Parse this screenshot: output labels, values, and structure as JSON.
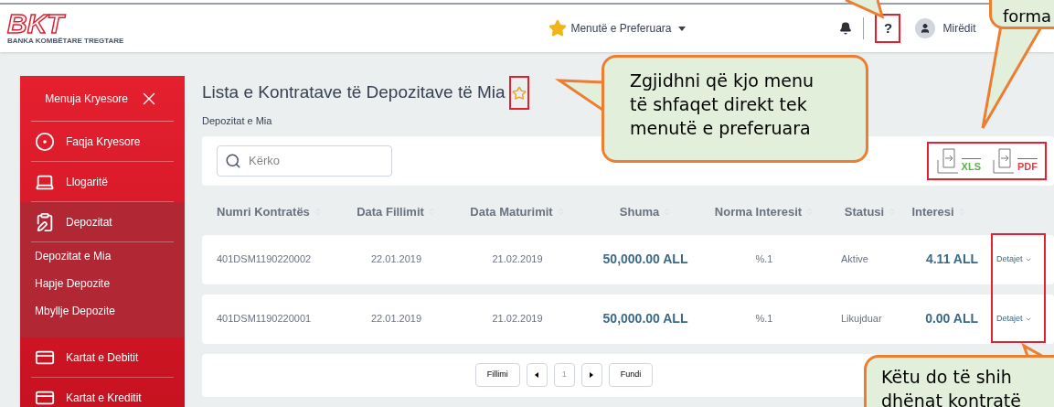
{
  "header": {
    "logo_text": "BKT",
    "logo_subtitle": "BANKA KOMBËTARE TREGTARE",
    "favorites": "Menutë e Preferuara",
    "help": "?",
    "greeting": "Mirëdit"
  },
  "sidebar": {
    "title": "Menuja Kryesore",
    "items": [
      {
        "label": "Faqja Kryesore",
        "kind": "home",
        "expanded": false
      },
      {
        "label": "Llogaritë",
        "kind": "accounts",
        "expanded": false
      },
      {
        "label": "Depozitat",
        "kind": "deposits",
        "expanded": true,
        "children": [
          {
            "label": "Depozitat e Mia"
          },
          {
            "label": "Hapje Depozite"
          },
          {
            "label": "Mbyllje Depozite"
          }
        ]
      },
      {
        "label": "Kartat e Debitit",
        "kind": "debit",
        "expanded": false
      },
      {
        "label": "Kartat e Kreditit",
        "kind": "credit",
        "expanded": false
      }
    ]
  },
  "page": {
    "title": "Lista e Kontratave të Depozitave të Mia",
    "breadcrumb": "Depozitat e Mia"
  },
  "search": {
    "placeholder": "Kërko"
  },
  "exports": [
    "XLS",
    "PDF"
  ],
  "table": {
    "columns": [
      "Numri Kontratës",
      "Data Fillimit",
      "Data Maturimit",
      "Shuma",
      "Norma Interesit",
      "Statusi",
      "Interesi"
    ],
    "rows": [
      {
        "cells": [
          "401DSM1190220002",
          "22.01.2019",
          "21.02.2019",
          "50,000.00 ALL",
          "%.1",
          "Aktive",
          "4.11 ALL"
        ],
        "action": "Detajet"
      },
      {
        "cells": [
          "401DSM1190220001",
          "22.01.2019",
          "21.02.2019",
          "50,000.00 ALL",
          "%.1",
          "Likujduar",
          "0.00 ALL"
        ],
        "action": "Detajet"
      }
    ]
  },
  "pagination": {
    "first": "Fillimi",
    "pages": [
      {
        "label": "1",
        "selected": true
      }
    ],
    "last": "Fundi"
  },
  "callouts": [
    {
      "kind": "favorite",
      "text": "Zgjidhni që kjo menu\ntë shfaqet direkt tek\nmenutë e preferuara"
    },
    {
      "kind": "export",
      "text": "forma"
    },
    {
      "kind": "details",
      "text": "Këtu do të shih\ndhënat kontratë"
    }
  ]
}
